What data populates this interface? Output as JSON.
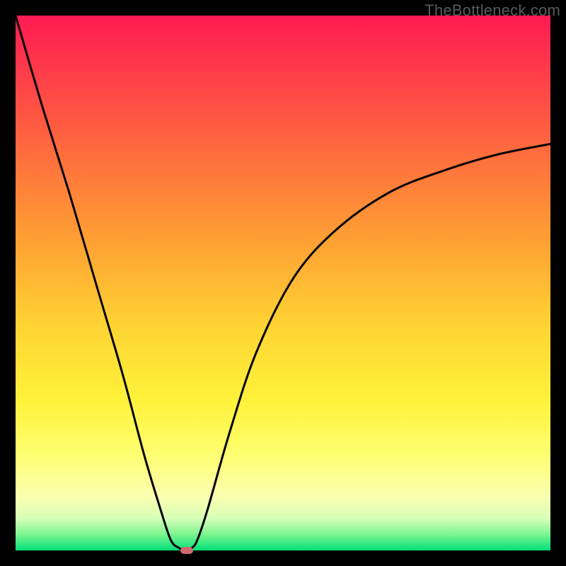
{
  "watermark": "TheBottleneck.com",
  "colors": {
    "background": "#000000",
    "curve": "#000000",
    "marker": "#d06a6e",
    "gradient_stops": [
      "#ff1a52",
      "#ff3a4a",
      "#ff6a3e",
      "#ffa033",
      "#ffd333",
      "#fff23a",
      "#ffff70",
      "#f9ffb0",
      "#d8ffb8",
      "#7cf58e",
      "#00e07a"
    ]
  },
  "chart_data": {
    "type": "line",
    "title": "",
    "xlabel": "",
    "ylabel": "",
    "xlim": [
      0,
      100
    ],
    "ylim": [
      0,
      100
    ],
    "series": [
      {
        "name": "curve",
        "x": [
          0,
          5,
          10,
          15,
          20,
          24,
          27,
          29,
          30.5,
          32,
          33,
          34,
          36,
          40,
          45,
          52,
          60,
          70,
          80,
          90,
          100
        ],
        "y": [
          100,
          83,
          67,
          50,
          33,
          18,
          8,
          2,
          0.5,
          0,
          0.5,
          2,
          8,
          22,
          37,
          51,
          60,
          67,
          71,
          74,
          76
        ]
      }
    ],
    "marker": {
      "x": 32,
      "y": 0,
      "label": ""
    },
    "grid": false,
    "legend": false,
    "annotations": []
  }
}
